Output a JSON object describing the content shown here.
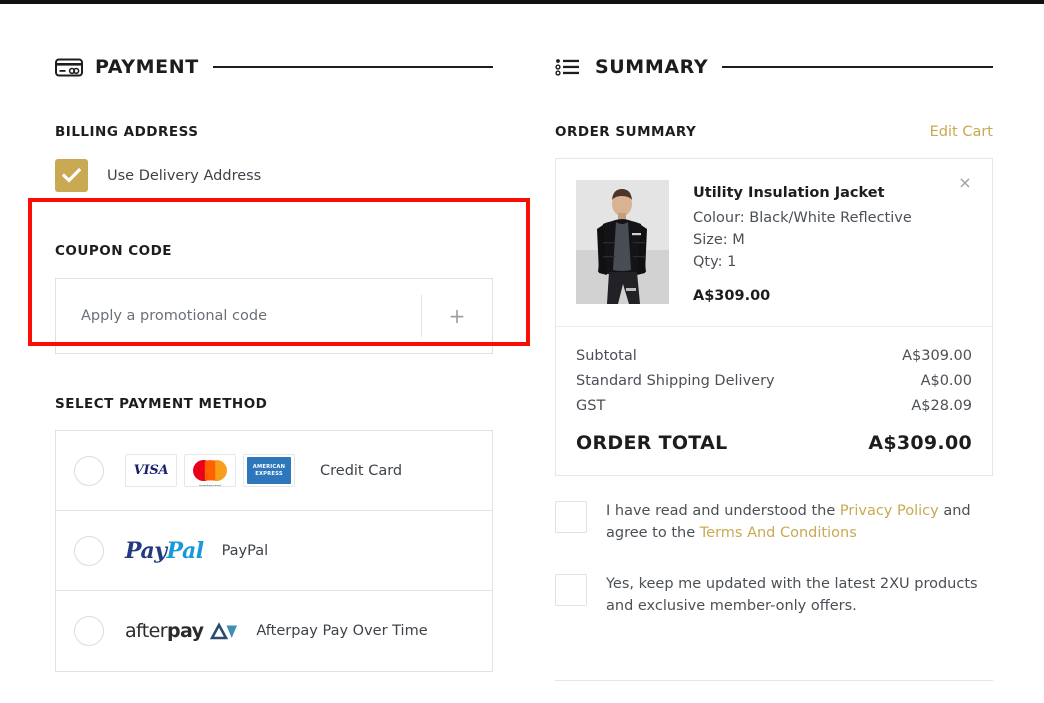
{
  "payment": {
    "section_title": "PAYMENT",
    "section_icon": "credit-card-icon",
    "billing": {
      "heading": "BILLING ADDRESS",
      "checkbox_label": "Use Delivery Address",
      "checked": true
    },
    "coupon": {
      "heading": "COUPON CODE",
      "placeholder": "Apply a promotional code",
      "value": "",
      "add_label": "+",
      "highlight_color": "#fa0f08"
    },
    "methods": {
      "heading": "SELECT PAYMENT METHOD",
      "items": [
        {
          "label": "Credit Card",
          "selected": false,
          "logos": [
            "visa-logo",
            "mastercard-logo",
            "amex-logo"
          ]
        },
        {
          "label": "PayPal",
          "selected": false,
          "logos": [
            "paypal-logo"
          ]
        },
        {
          "label": "Afterpay Pay Over Time",
          "selected": false,
          "logos": [
            "afterpay-logo"
          ]
        }
      ]
    }
  },
  "summary": {
    "section_title": "SUMMARY",
    "section_icon": "list-icon",
    "order_heading": "ORDER SUMMARY",
    "edit_cart_label": "Edit Cart",
    "remove_label": "×",
    "product": {
      "name": "Utility Insulation Jacket",
      "colour": "Colour: Black/White Reflective",
      "size": "Size: M",
      "qty": "Qty: 1",
      "price": "A$309.00"
    },
    "totals": [
      {
        "label": "Subtotal",
        "value": "A$309.00"
      },
      {
        "label": "Standard Shipping Delivery",
        "value": "A$0.00"
      },
      {
        "label": "GST",
        "value": "A$28.09"
      }
    ],
    "grand_total": {
      "label": "ORDER TOTAL",
      "value": "A$309.00"
    },
    "consents": [
      {
        "text_a": "I have read and understood the ",
        "link_a": "Privacy Policy",
        "text_b": " and agree to the ",
        "link_b": "Terms And Conditions",
        "text_c": "",
        "checked": false
      },
      {
        "text_a": "Yes, keep me updated with the latest 2XU products and exclusive member-only offers.",
        "link_a": "",
        "text_b": "",
        "link_b": "",
        "text_c": "",
        "checked": false
      }
    ]
  },
  "colors": {
    "accent_gold": "#c9a951",
    "highlight_red": "#fa0f08",
    "text_dark": "#1d1d1d",
    "text_body": "#4b5056",
    "border": "#e2e2e2"
  }
}
